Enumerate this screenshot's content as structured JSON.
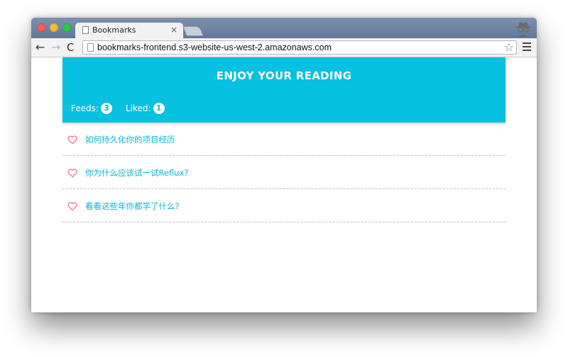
{
  "browser": {
    "tab_title": "Bookmarks",
    "tab_close": "×",
    "url": "bookmarks-frontend.s3-website-us-west-2.amazonaws.com",
    "icons": {
      "back": "←",
      "forward": "→",
      "reload": "C",
      "star": "☆"
    }
  },
  "header": {
    "title": "ENJOY YOUR READING",
    "feeds_label": "Feeds:",
    "feeds_count": "3",
    "liked_label": "Liked:",
    "liked_count": "1"
  },
  "feeds": [
    {
      "title": "如何持久化你的项目经历"
    },
    {
      "title": "你为什么应该试一试Reflux?"
    },
    {
      "title": "看看这些年你都学了什么?"
    }
  ],
  "colors": {
    "accent": "#06c1e0",
    "heart": "#f06292",
    "link": "#06b5d6"
  }
}
